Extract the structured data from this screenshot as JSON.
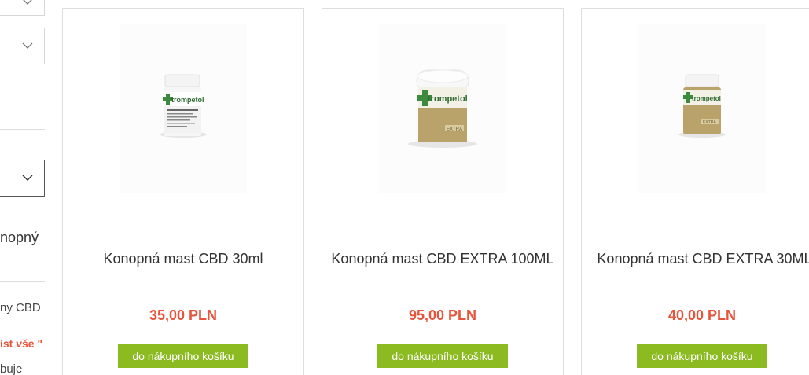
{
  "sidebar": {
    "partial_heading": "nopný",
    "partial_item": "ny CBD",
    "read_more": "íst vše \"",
    "partial_text": "buje"
  },
  "products": [
    {
      "name": "Konopná mast CBD 30ml",
      "price": "35,00 PLN",
      "button": "do nákupního košíku",
      "image_brand": "trompetol",
      "jar": "small-white-lid"
    },
    {
      "name": "Konopná mast CBD EXTRA 100ML",
      "price": "95,00 PLN",
      "button": "do nákupního košíku",
      "image_brand": "trompetol",
      "jar": "large-wide"
    },
    {
      "name": "Konopná mast CBD EXTRA 30ML",
      "price": "40,00 PLN",
      "button": "do nákupního košíku",
      "image_brand": "trompetol",
      "jar": "small-extra"
    }
  ],
  "colors": {
    "price": "#e8543b",
    "button": "#8bbb21",
    "border": "#dedede"
  }
}
